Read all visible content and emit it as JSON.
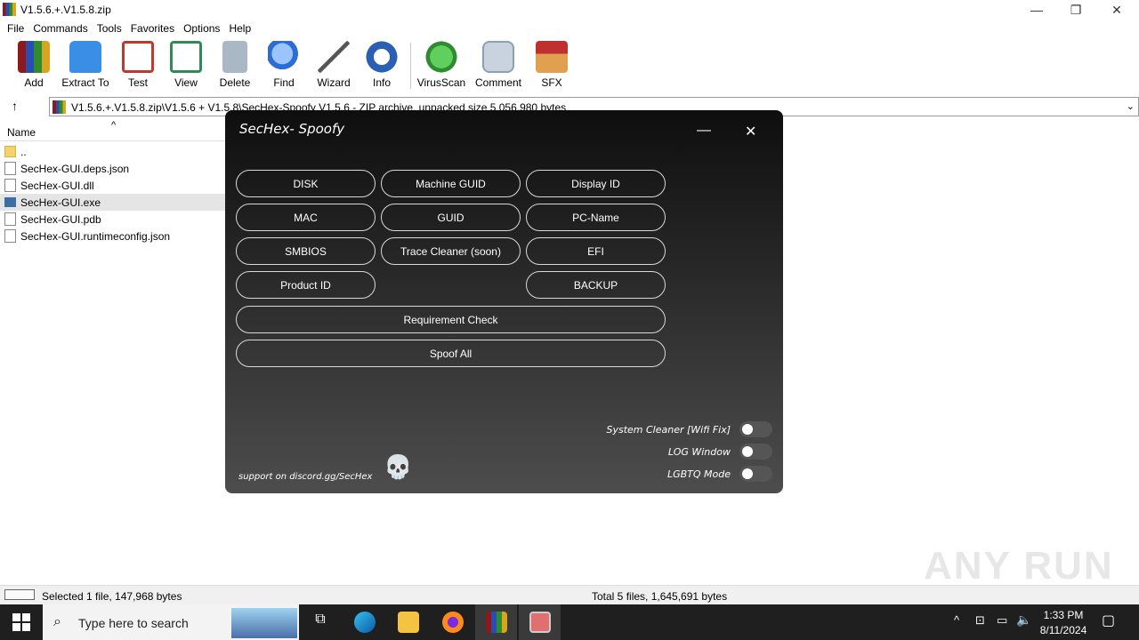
{
  "window": {
    "title": "V1.5.6.+.V1.5.8.zip",
    "controls": {
      "minimize": "—",
      "restore": "❐",
      "close": "✕"
    }
  },
  "menu": [
    "File",
    "Commands",
    "Tools",
    "Favorites",
    "Options",
    "Help"
  ],
  "toolbar": [
    {
      "label": "Add",
      "icon": "add-archive-icon",
      "color": "#8b1a1a"
    },
    {
      "label": "Extract To",
      "icon": "extract-folder-icon",
      "color": "#3a8ee6"
    },
    {
      "label": "Test",
      "icon": "test-clipboard-icon",
      "color": "#c0392b"
    },
    {
      "label": "View",
      "icon": "view-book-icon",
      "color": "#2e8b57"
    },
    {
      "label": "Delete",
      "icon": "trash-icon",
      "color": "#8fa3b8"
    },
    {
      "label": "Find",
      "icon": "find-magnifier-icon",
      "color": "#2b6cd6"
    },
    {
      "label": "Wizard",
      "icon": "wizard-wand-icon",
      "color": "#c49a2b"
    },
    {
      "label": "Info",
      "icon": "info-icon",
      "color": "#2b5fb3"
    },
    {
      "label": "VirusScan",
      "icon": "virus-scan-icon",
      "color": "#3fae3f"
    },
    {
      "label": "Comment",
      "icon": "comment-icon",
      "color": "#8aa0b5"
    },
    {
      "label": "SFX",
      "icon": "sfx-box-icon",
      "color": "#d9883a"
    }
  ],
  "address": {
    "path": "V1.5.6.+.V1.5.8.zip\\V1.5.6  + V1.5.8\\SecHex-Spoofy V1.5.6 - ZIP archive, unpacked size 5,056,980 bytes"
  },
  "filelist": {
    "header": "Name",
    "sort_indicator": "^",
    "items": [
      {
        "name": "..",
        "type": "folder"
      },
      {
        "name": "SecHex-GUI.deps.json",
        "type": "file"
      },
      {
        "name": "SecHex-GUI.dll",
        "type": "file"
      },
      {
        "name": "SecHex-GUI.exe",
        "type": "exe",
        "selected": true
      },
      {
        "name": "SecHex-GUI.pdb",
        "type": "file"
      },
      {
        "name": "SecHex-GUI.runtimeconfig.json",
        "type": "file"
      }
    ]
  },
  "status": {
    "left": "Selected 1 file, 147,968 bytes",
    "right": "Total 5 files, 1,645,691 bytes"
  },
  "dialog": {
    "title": "SecHex- Spoofy",
    "minimize": "—",
    "close": "✕",
    "buttons": {
      "disk": "DISK",
      "machine_guid": "Machine GUID",
      "display_id": "Display ID",
      "mac": "MAC",
      "guid": "GUID",
      "pc_name": "PC-Name",
      "smbios": "SMBIOS",
      "trace_cleaner": "Trace Cleaner (soon)",
      "efi": "EFI",
      "product_id": "Product ID",
      "backup": "BACKUP",
      "requirement_check": "Requirement Check",
      "spoof_all": "Spoof All"
    },
    "toggles": [
      {
        "label": "System Cleaner [Wifi Fix]",
        "on": false
      },
      {
        "label": "LOG Window",
        "on": false
      },
      {
        "label": "LGBTQ Mode",
        "on": false
      }
    ],
    "support": "support on discord.gg/SecHex",
    "skull": "💀"
  },
  "watermark": "ANY RUN",
  "taskbar": {
    "search_placeholder": "Type here to search",
    "time": "1:33 PM",
    "date": "8/11/2024"
  }
}
